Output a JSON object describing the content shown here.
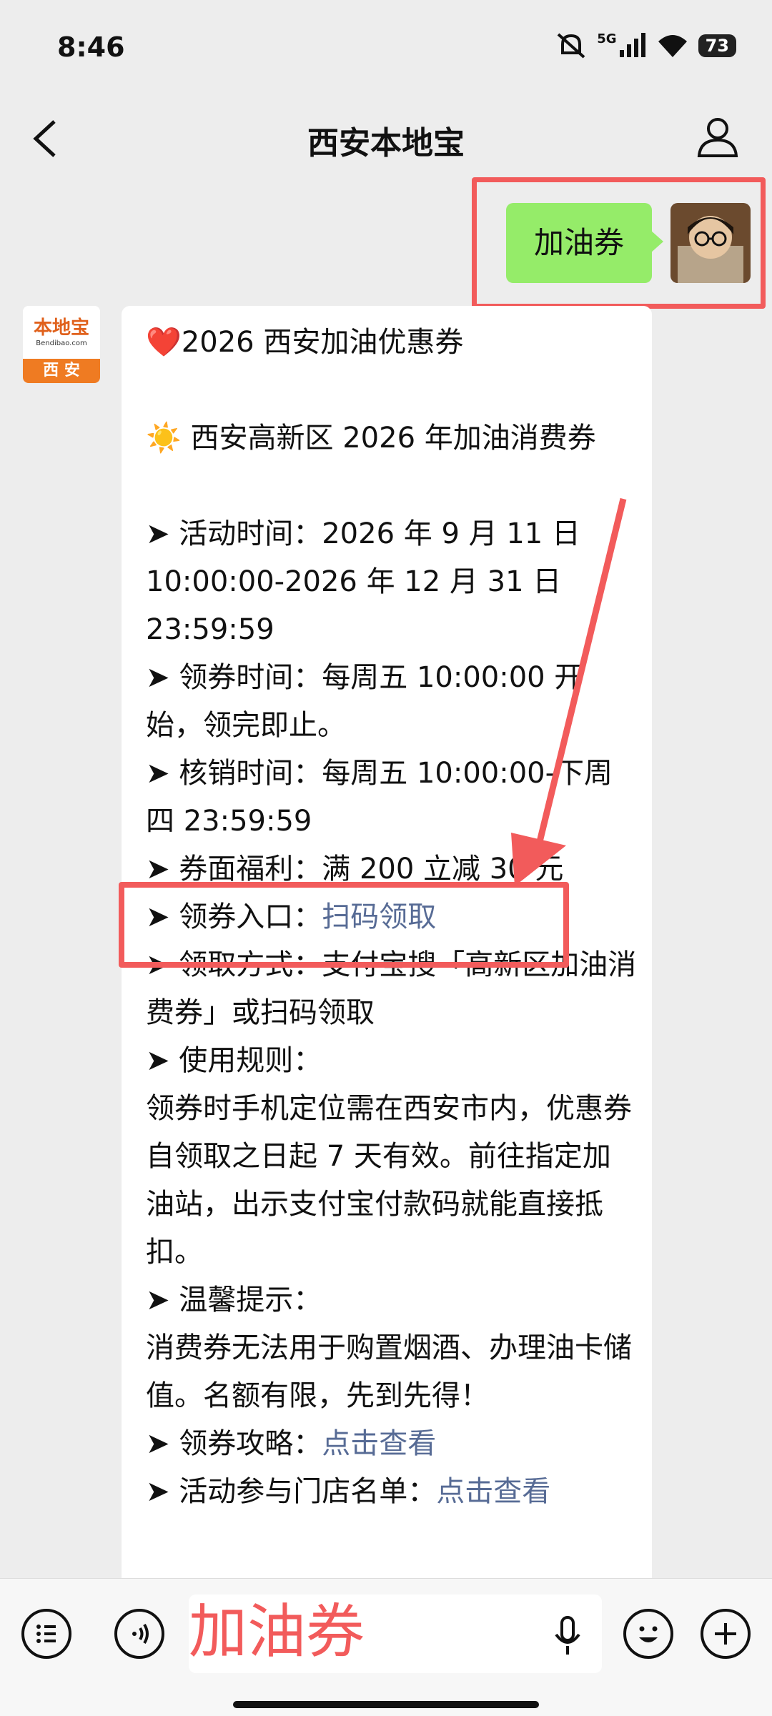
{
  "status_bar": {
    "time": "8:46",
    "network": "5G",
    "battery": "73"
  },
  "nav": {
    "title": "西安本地宝"
  },
  "sent": {
    "text": "加油券"
  },
  "avatar_logo": {
    "line1": "本地宝",
    "line2": "Bendibao.com",
    "line3": "西 安"
  },
  "message": {
    "line1": "❤️2026 西安加油优惠券",
    "line2": "☀️ 西安高新区 2026 年加油消费券",
    "time_label": "➤ 活动时间：",
    "time_value": "2026 年 9 月 11 日 10:00:00-2026 年 12 月 31 日 23:59:59",
    "claim_label": "➤ 领券时间：",
    "claim_value": "每周五 10:00:00 开始，领完即止。",
    "verify_label": "➤ 核销时间：",
    "verify_value": "每周五 10:00:00-下周四 23:59:59",
    "benefit_label": "➤ 券面福利：",
    "benefit_value": "满 200 立减 30 元",
    "entry_label": "➤ 领券入口：",
    "entry_link": "扫码领取",
    "method_label": "➤ 领取方式：",
    "method_value": "支付宝搜「高新区加油消费券」或扫码领取",
    "rules_label": "➤ 使用规则：",
    "rules_value": "领券时手机定位需在西安市内，优惠券自领取之日起 7 天有效。前往指定加油站，出示支付宝付款码就能直接抵扣。",
    "tips_label": "➤ 温馨提示：",
    "tips_value": "消费券无法用于购置烟酒、办理油卡储值。名额有限，先到先得！",
    "guide_label": "➤ 领券攻略：",
    "guide_link": "点击查看",
    "stores_label": "➤ 活动参与门店名单：",
    "stores_link": "点击查看"
  },
  "input": {
    "text": "加油券"
  },
  "colors": {
    "bubble_sent": "#95ec69",
    "link": "#576b95",
    "highlight": "#f25b5b"
  }
}
